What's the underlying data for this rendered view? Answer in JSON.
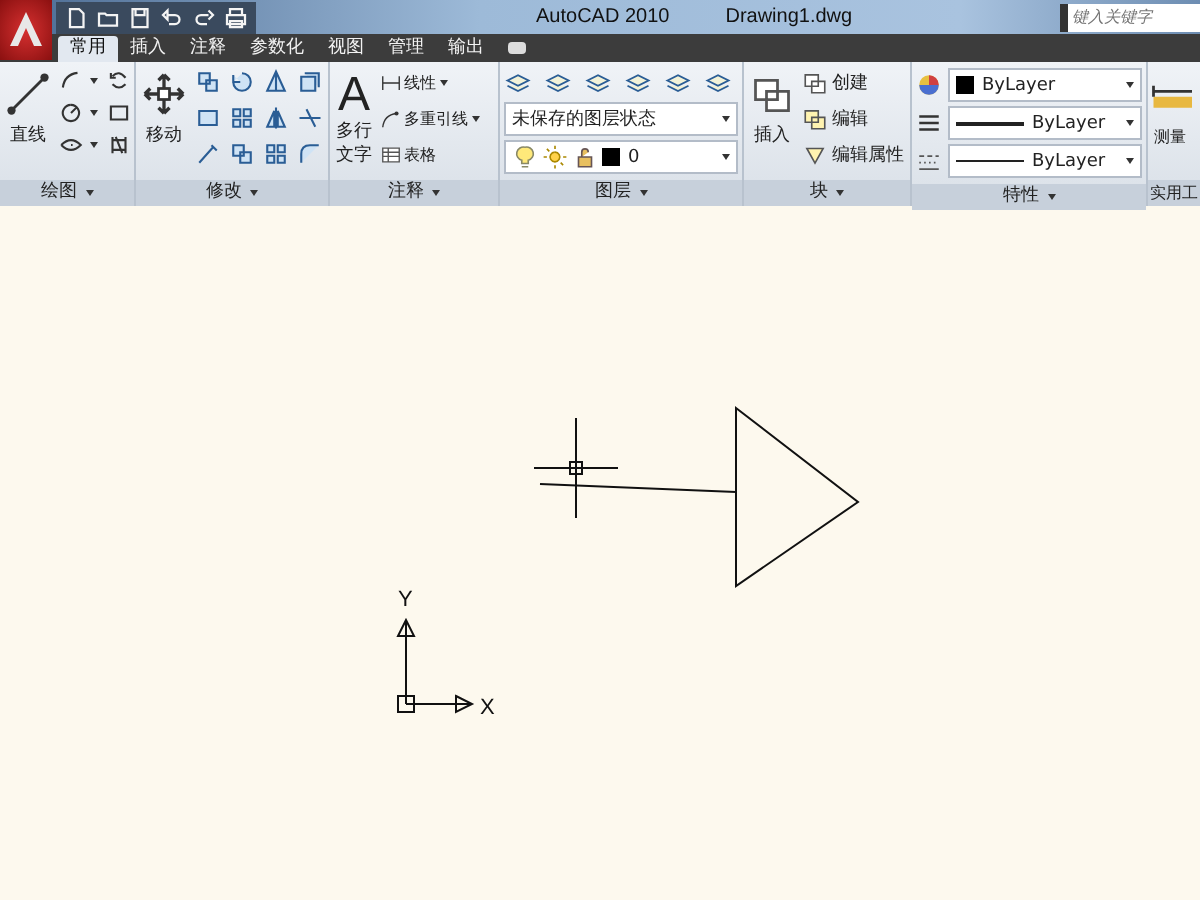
{
  "title_bar": {
    "app": "AutoCAD 2010",
    "file": "Drawing1.dwg",
    "search_placeholder": "键入关键字"
  },
  "tabs": [
    {
      "label": "常用",
      "selected": true
    },
    {
      "label": "插入",
      "selected": false
    },
    {
      "label": "注释",
      "selected": false
    },
    {
      "label": "参数化",
      "selected": false
    },
    {
      "label": "视图",
      "selected": false
    },
    {
      "label": "管理",
      "selected": false
    },
    {
      "label": "输出",
      "selected": false
    }
  ],
  "draw_panel": {
    "title": "绘图",
    "line_button": "直线"
  },
  "modify_panel": {
    "title": "修改",
    "move_button": "移动"
  },
  "annotate_panel": {
    "title": "注释",
    "mtext_glyph": "A",
    "mtext_lines": [
      "多行",
      "文字"
    ],
    "linear": "线性",
    "mleader": "多重引线",
    "table": "表格"
  },
  "layers_panel": {
    "title": "图层",
    "layer_state": "未保存的图层状态",
    "current_layer": "0"
  },
  "block_panel": {
    "title": "块",
    "insert": "插入",
    "create": "创建",
    "edit": "编辑",
    "edit_attributes": "编辑属性"
  },
  "properties_panel": {
    "title": "特性",
    "color_value": "ByLayer",
    "lineweight": "ByLayer",
    "linetype": "ByLayer"
  },
  "utilities_panel": {
    "title": "实用工",
    "measure": "测量"
  },
  "canvas": {
    "y_label": "Y",
    "x_label": "X"
  }
}
